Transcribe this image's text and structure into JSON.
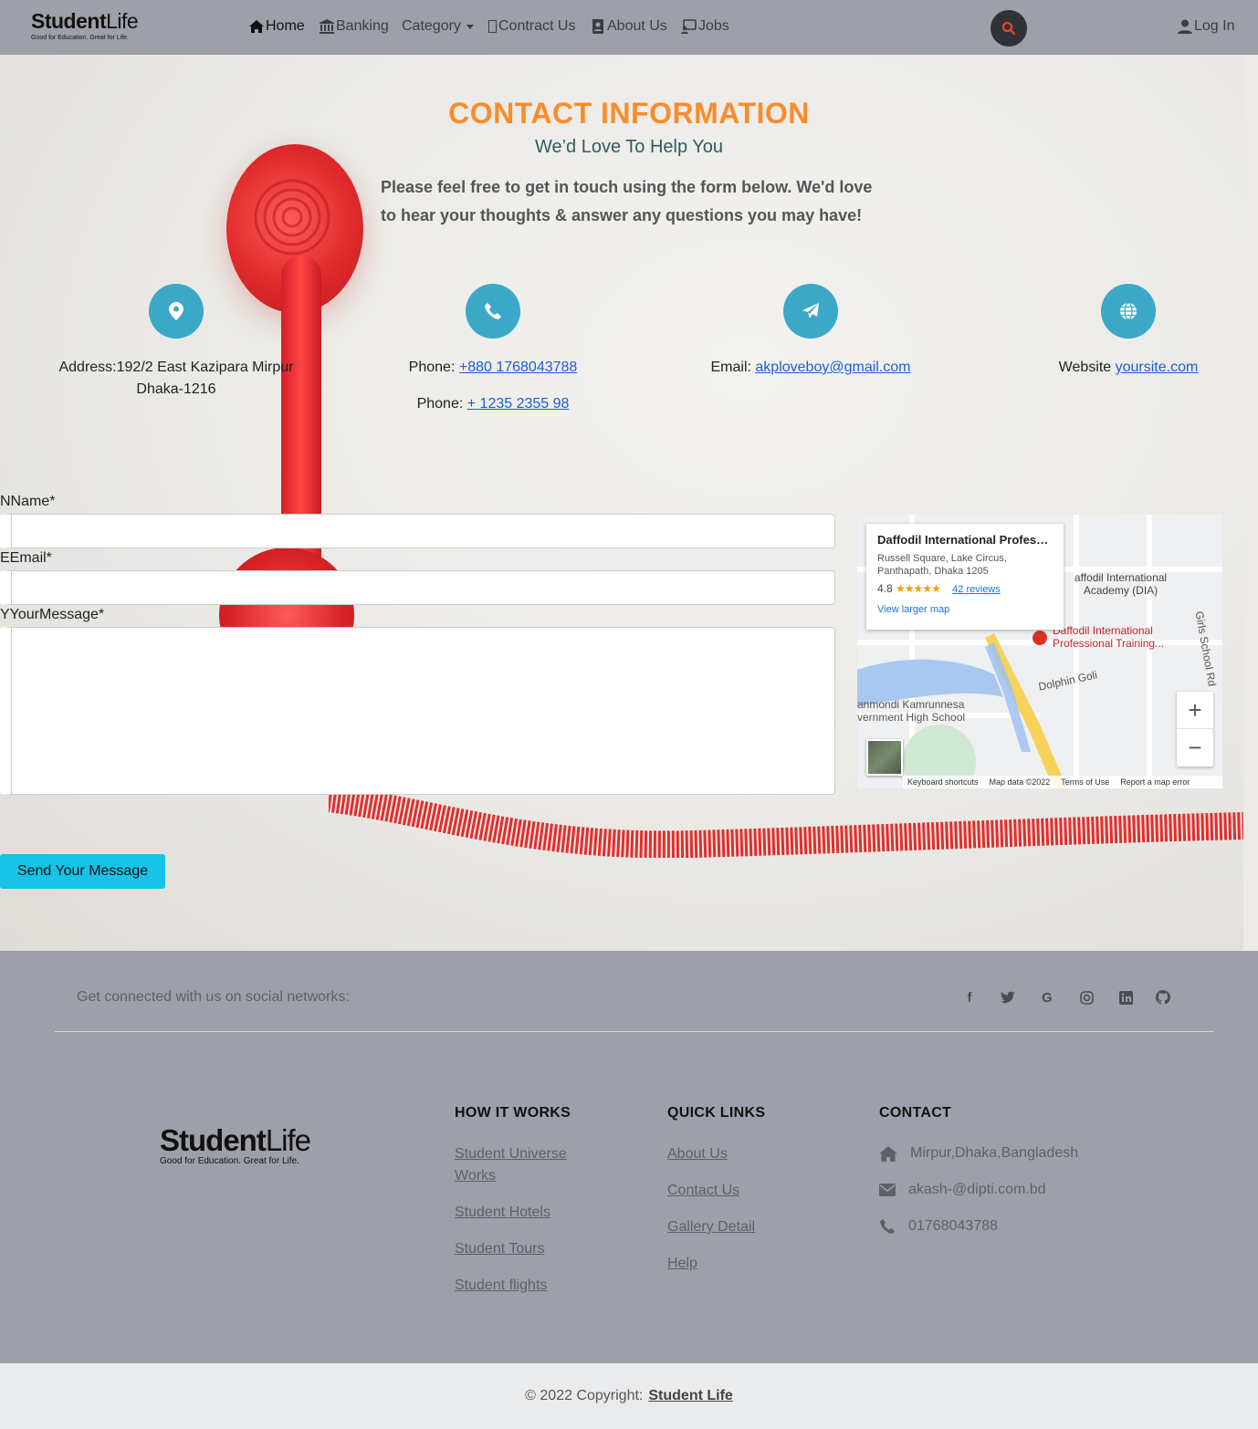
{
  "nav": {
    "logo_bold": "Student",
    "logo_light": "Life",
    "logo_tagline": "Good for Education. Great for Life.",
    "items": [
      {
        "label": "Home",
        "icon": "home-icon"
      },
      {
        "label": "Banking",
        "icon": "bank-icon"
      },
      {
        "label": "Category",
        "icon": "caret-down-icon"
      },
      {
        "label": "Contract Us",
        "icon": "missing-glyph-icon"
      },
      {
        "label": "About Us",
        "icon": "contact-card-icon"
      },
      {
        "label": "Jobs",
        "icon": "jobs-icon"
      }
    ],
    "login_label": "Log In"
  },
  "contact": {
    "title": "CONTACT INFORMATION",
    "subtitle": "We’d Love To Help You",
    "intro": "Please feel free to get in touch using the form below. We'd love to hear your thoughts & answer any questions you may have!",
    "address": "Address:192/2 East Kazipara Mirpur Dhaka-1216",
    "phone_label": "Phone:",
    "phone1": "+880 1768043788",
    "phone2": "+ 1235 2355 98",
    "email_label": "Email:",
    "email": "akploveboy@gmail.com",
    "website_label": "Website",
    "website": "yoursite.com"
  },
  "form": {
    "name_label": "NName*",
    "email_label": "EEmail*",
    "message_label": "YYourMessage*",
    "send_label": "Send Your Message"
  },
  "map": {
    "place_name": "Daffodil International Professi...",
    "place_address": "Russell Square, Lake Circus, Panthapath, Dhaka 1205",
    "rating": "4.8",
    "stars": "★★★★★",
    "reviews": "42 reviews",
    "larger_map": "View larger map",
    "label_academy": "affodil International Academy (DIA)",
    "label_training": "Daffodil International Professional Training...",
    "label_school": "anmondi Kamrunnesa vernment High School",
    "label_dolphin": "Dolphin Goli",
    "label_girls": "Girls School Rd",
    "footer": [
      "Keyboard shortcuts",
      "Map data ©2022",
      "Terms of Use",
      "Report a map error"
    ]
  },
  "footer": {
    "social_text": "Get connected with us on social networks:",
    "social": [
      "facebook-icon",
      "twitter-icon",
      "google-icon",
      "instagram-icon",
      "linkedin-icon",
      "github-icon"
    ],
    "logo_bold": "Student",
    "logo_light": "Life",
    "logo_tagline": "Good for Education. Great for Life.",
    "how_title": "HOW IT WORKS",
    "how_links": [
      "Student Universe Works",
      "Student Hotels",
      "Student Tours",
      "Student flights"
    ],
    "quick_title": "QUICK LINKS",
    "quick_links": [
      "About Us",
      "Contact Us",
      "Gallery Detail",
      "Help"
    ],
    "contact_title": "CONTACT",
    "contact_address": "Mirpur,Dhaka,Bangladesh",
    "contact_email": "akash-@dipti.com.bd",
    "contact_phone": "01768043788",
    "copyright": "© 2022 Copyright:",
    "copyright_link": "Student Life"
  },
  "colors": {
    "title": "#fa8c2a",
    "icon_circle": "#3ba8c8",
    "send_button": "#17c3e6",
    "nav_bg": "#9ea0a9"
  }
}
